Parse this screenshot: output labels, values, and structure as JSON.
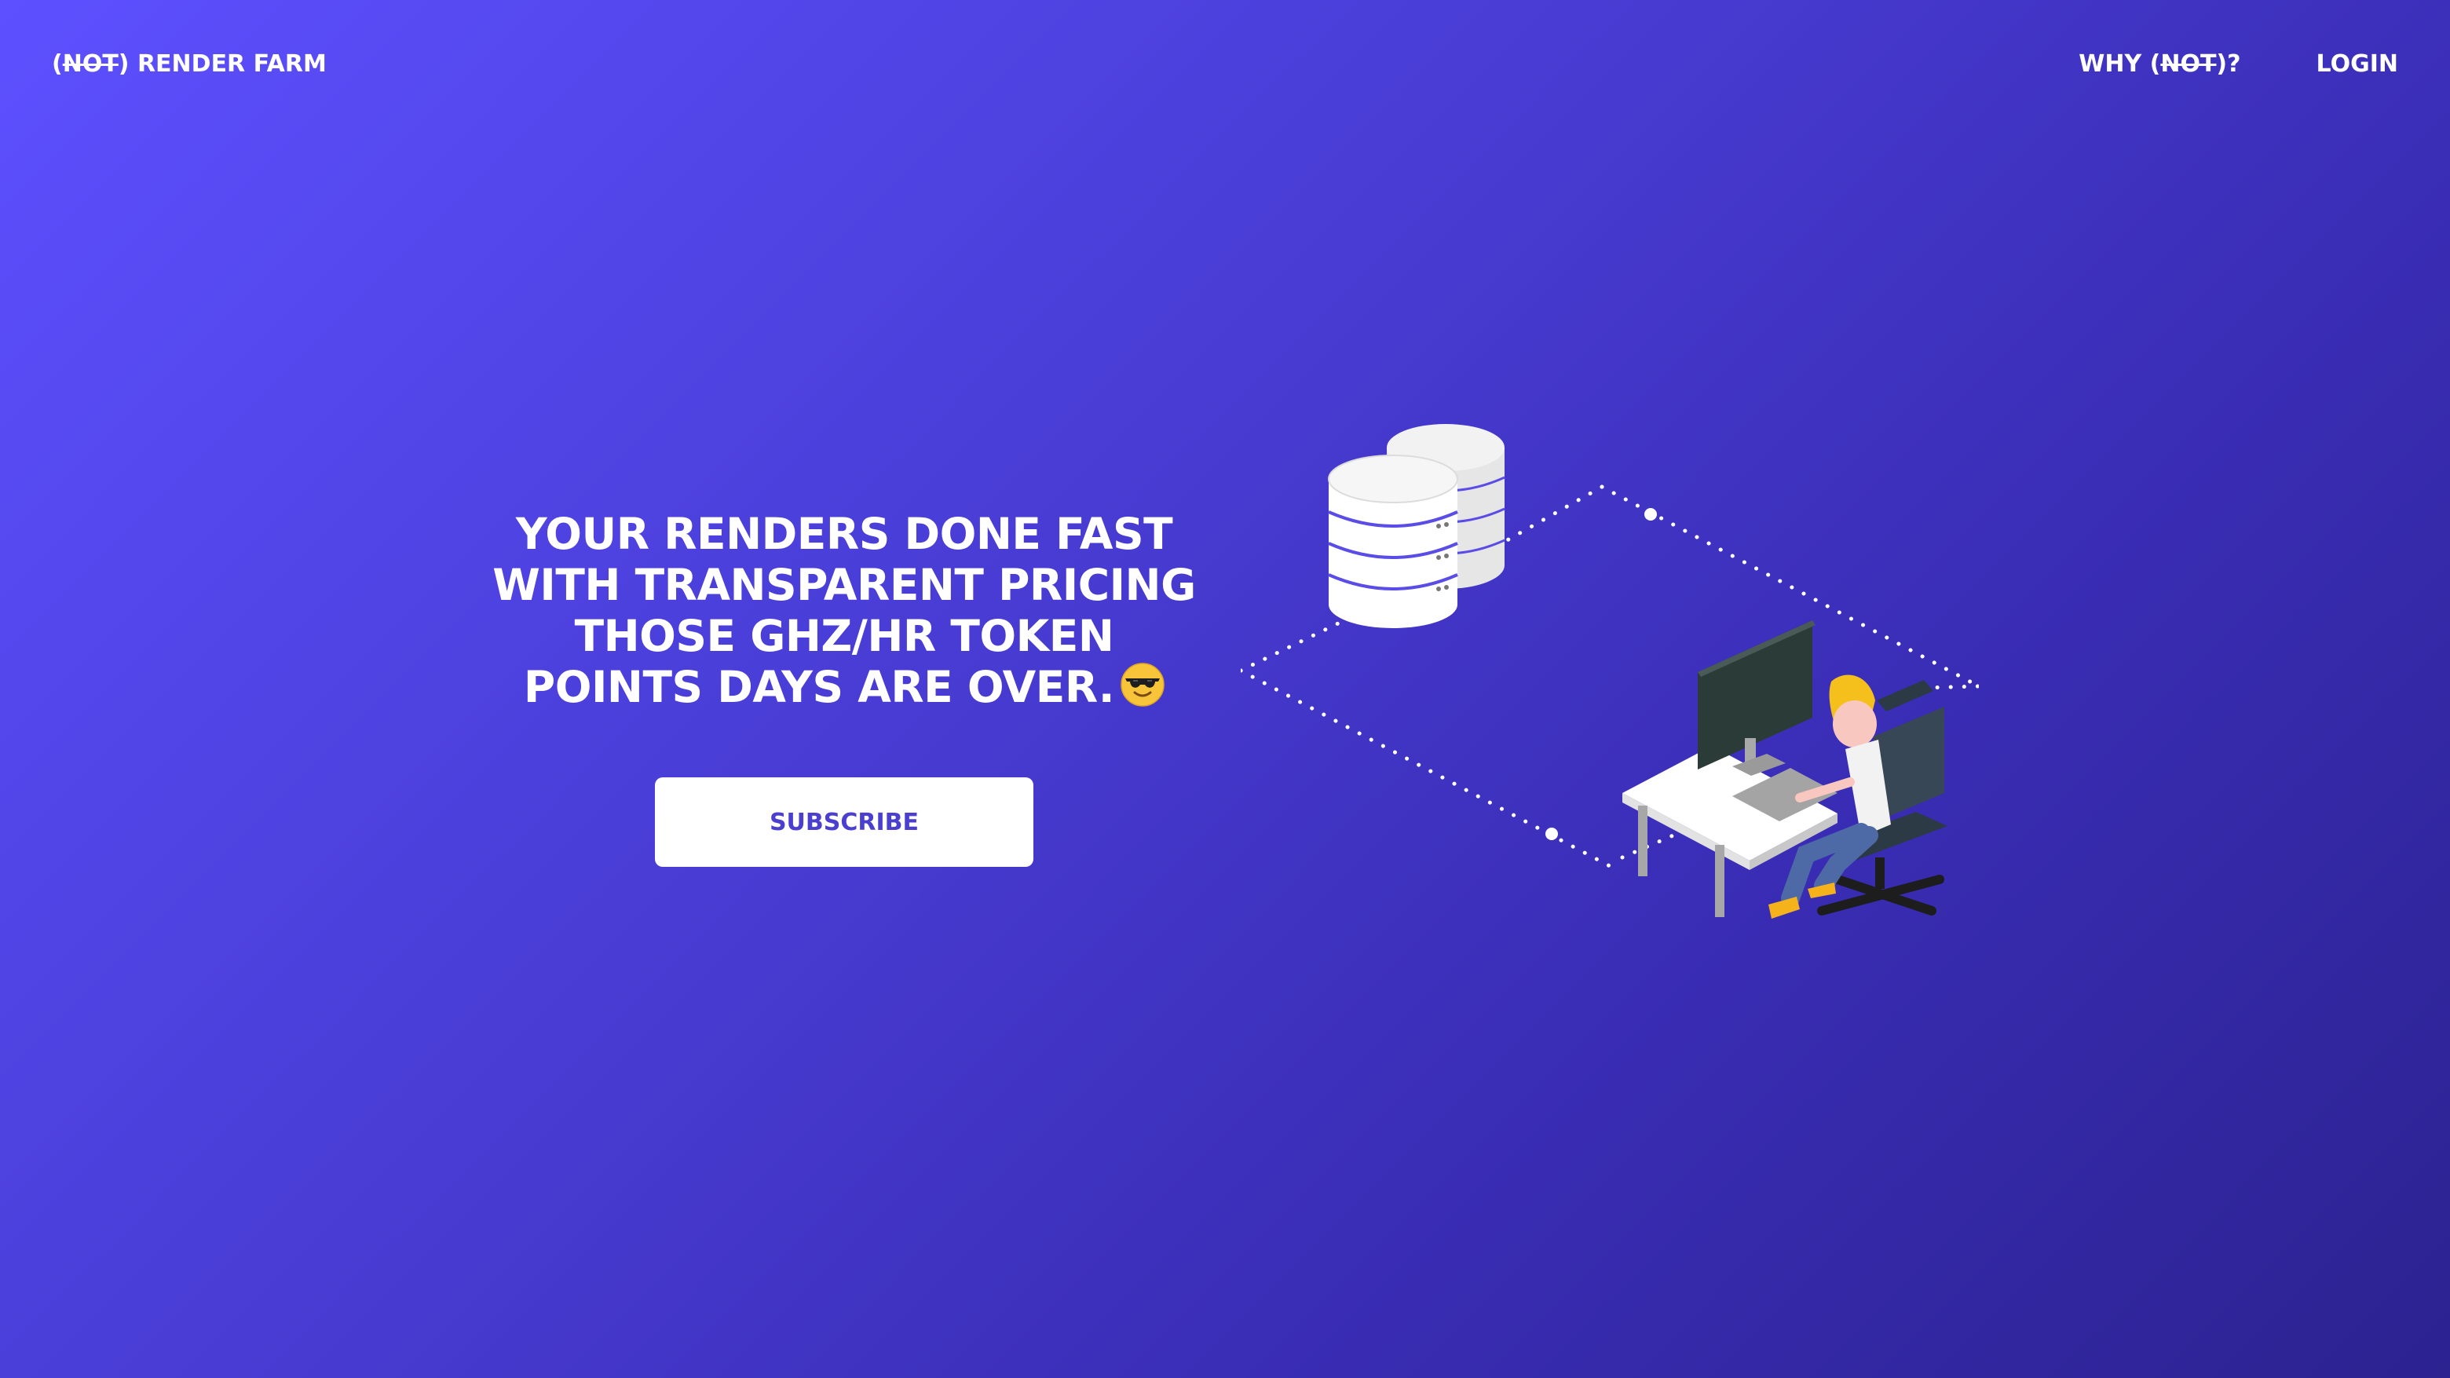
{
  "header": {
    "brand_strike": "NOT",
    "brand_rest": " RENDER FARM",
    "nav": {
      "why_prefix": "WHY (",
      "why_strike": "NOT",
      "why_suffix": ")?",
      "login": "LOGIN"
    }
  },
  "hero": {
    "headline_lines": [
      "YOUR RENDERS DONE FAST",
      "WITH TRANSPARENT PRICING",
      "THOSE GHZ/HR TOKEN",
      "POINTS DAYS ARE OVER."
    ],
    "emoji": "sunglasses-emoji",
    "cta_label": "SUBSCRIBE"
  },
  "illustration": {
    "subject": "servers-and-artist-at-desk",
    "colors": {
      "server": "#ffffff",
      "server_stripe": "#5a4ce6",
      "hair": "#f5c01b",
      "shoes": "#f5b21b",
      "pants": "#4d6aa6",
      "chair": "#384755",
      "desk": "#ffffff",
      "monitor": "#2a3a36"
    }
  },
  "theme": {
    "bg_start": "#5d50ff",
    "bg_end": "#2c2290",
    "cta_text": "#4a3fcf"
  }
}
